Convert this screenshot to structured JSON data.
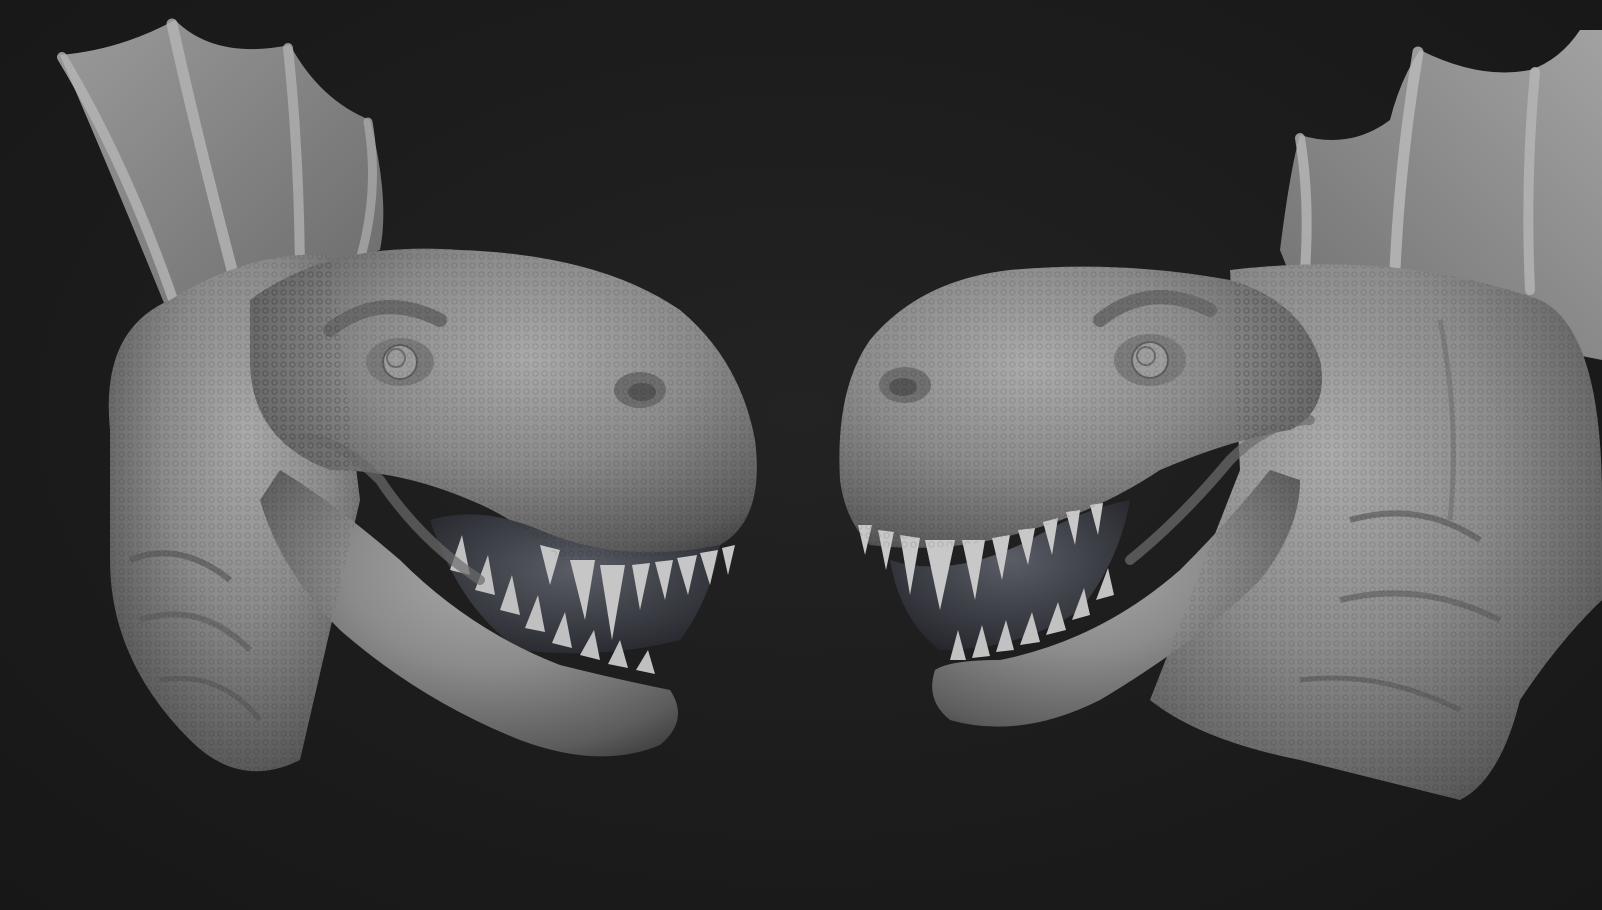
{
  "scene": {
    "background_color": "#1c1c1c",
    "material_color": "#8e8e8e",
    "material_highlight": "#b4b4b4",
    "material_shadow": "#4a4a4a",
    "mouth_interior_color": "#2e2f33",
    "teeth_color": "#c4c4c4"
  },
  "models": [
    {
      "name": "dino-head-left-view",
      "facing": "right"
    },
    {
      "name": "dino-head-right-view",
      "facing": "left"
    }
  ]
}
